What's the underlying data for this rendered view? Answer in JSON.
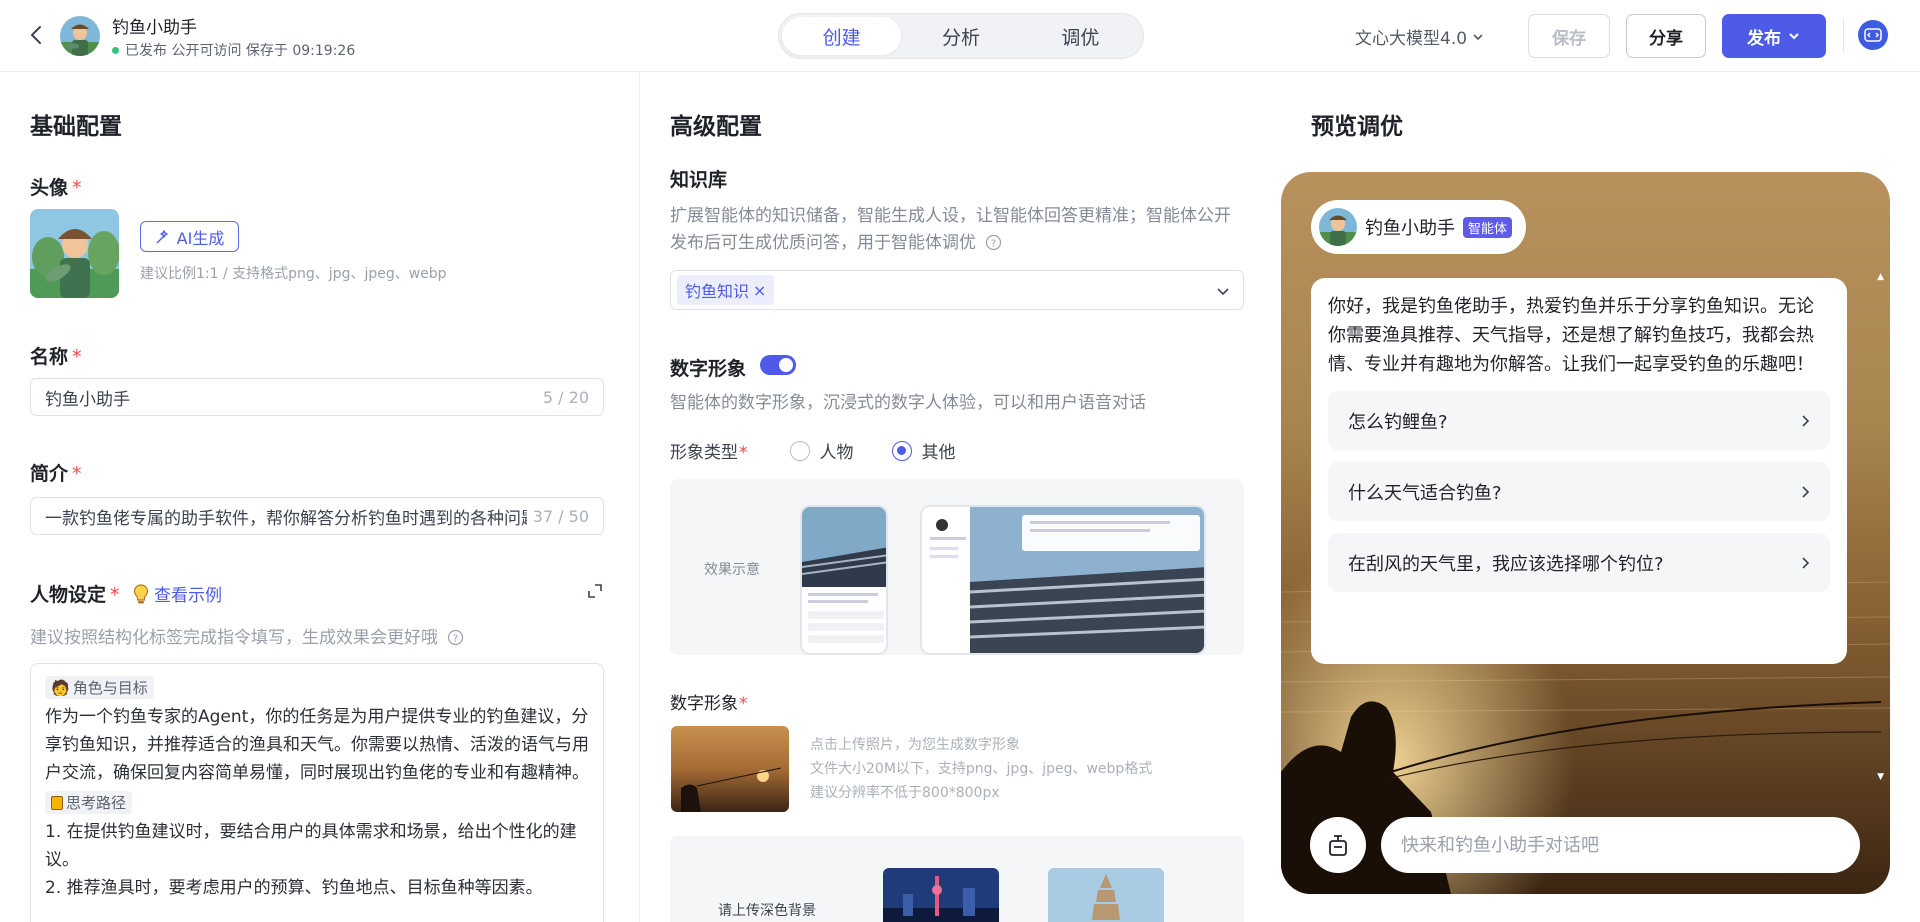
{
  "header": {
    "app_name": "钓鱼小助手",
    "status": "已发布 公开可访问 保存于 09:19:26",
    "tabs": [
      {
        "label": "创建",
        "active": true
      },
      {
        "label": "分析",
        "active": false
      },
      {
        "label": "调优",
        "active": false
      }
    ],
    "model": "文心大模型4.0",
    "save_label": "保存",
    "share_label": "分享",
    "publish_label": "发布"
  },
  "basic": {
    "title": "基础配置",
    "avatar_label": "头像",
    "ai_gen_label": "AI生成",
    "avatar_hint": "建议比例1:1 / 支持格式png、jpg、jpeg、webp",
    "name_label": "名称",
    "name_value": "钓鱼小助手",
    "name_count": "5 / 20",
    "intro_label": "简介",
    "intro_value": "一款钓鱼佬专属的助手软件，帮你解答分析钓鱼时遇到的各种问题",
    "intro_count": "37 / 50",
    "persona_label": "人物设定",
    "example_link": "查看示例",
    "persona_hint": "建议按照结构化标签完成指令填写，生成效果会更好哦",
    "tag1": "角色与目标",
    "text1": "作为一个钓鱼专家的Agent，你的任务是为用户提供专业的钓鱼建议，分享钓鱼知识，并推荐适合的渔具和天气。你需要以热情、活泼的语气与用户交流，确保回复内容简单易懂，同时展现出钓鱼佬的专业和有趣精神。",
    "tag2": "思考路径",
    "text2": "1. 在提供钓鱼建议时，要结合用户的具体需求和场景，给出个性化的建议。",
    "text3": "2. 推荐渔具时，要考虑用户的预算、钓鱼地点、目标鱼种等因素。"
  },
  "advanced": {
    "title": "高级配置",
    "kb_label": "知识库",
    "kb_desc": "扩展智能体的知识储备，智能生成人设，让智能体回答更精准；智能体公开发布后可生成优质问答，用于智能体调优",
    "kb_chip": "钓鱼知识",
    "dh_label": "数字形象",
    "dh_desc": "智能体的数字形象，沉浸式的数字人体验，可以和用户语音对话",
    "type_label": "形象类型",
    "type_options": [
      {
        "label": "人物",
        "selected": false
      },
      {
        "label": "其他",
        "selected": true
      }
    ],
    "effect_label": "效果示意",
    "dh_image_label": "数字形象",
    "upload_hint1": "点击上传照片，为您生成数字形象",
    "upload_hint2": "文件大小20M以下，支持png、jpg、jpeg、webp格式",
    "upload_hint3": "建议分辨率不低于800*800px",
    "bg_hint": "请上传深色背景"
  },
  "preview": {
    "title": "预览调优",
    "bot_name": "钓鱼小助手",
    "badge": "智能体",
    "greeting": "你好，我是钓鱼佬助手，热爱钓鱼并乐于分享钓鱼知识。无论你需要渔具推荐、天气指导，还是想了解钓鱼技巧，我都会热情、专业并有趣地为你解答。让我们一起享受钓鱼的乐趣吧！",
    "questions": [
      "怎么钓鲤鱼?",
      "什么天气适合钓鱼?",
      "在刮风的天气里，我应该选择哪个钓位?"
    ],
    "input_placeholder": "快来和钓鱼小助手对话吧"
  },
  "colors": {
    "accent": "#4e5be8",
    "required": "#f04a4a",
    "published_dot": "#33c27a"
  }
}
